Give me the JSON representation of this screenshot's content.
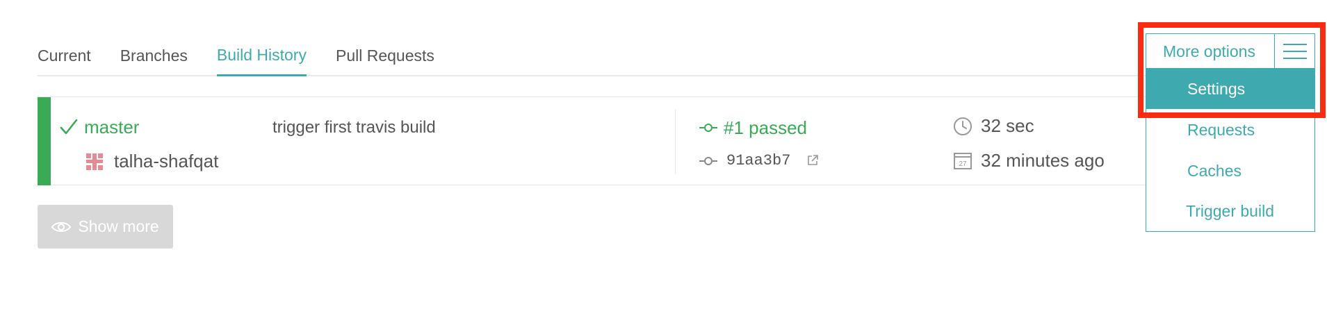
{
  "tabs": [
    {
      "label": "Current",
      "active": false
    },
    {
      "label": "Branches",
      "active": false
    },
    {
      "label": "Build History",
      "active": true
    },
    {
      "label": "Pull Requests",
      "active": false
    }
  ],
  "build": {
    "status_color": "#39aa56",
    "branch": "master",
    "commit_message": "trigger first travis build",
    "author": "talha-shafqat",
    "build_status": "#1 passed",
    "commit_sha": "91aa3b7",
    "duration": "32 sec",
    "finished": "32 minutes ago",
    "calendar_day": "27"
  },
  "show_more": {
    "label": "Show more"
  },
  "options": {
    "label": "More options",
    "items": [
      {
        "label": "Settings",
        "active": true
      },
      {
        "label": "Requests",
        "active": false
      },
      {
        "label": "Caches",
        "active": false
      },
      {
        "label": "Trigger build",
        "active": false
      }
    ]
  },
  "colors": {
    "accent": "#3eaaaf",
    "passed": "#39aa56",
    "highlight": "#ff2a12"
  }
}
